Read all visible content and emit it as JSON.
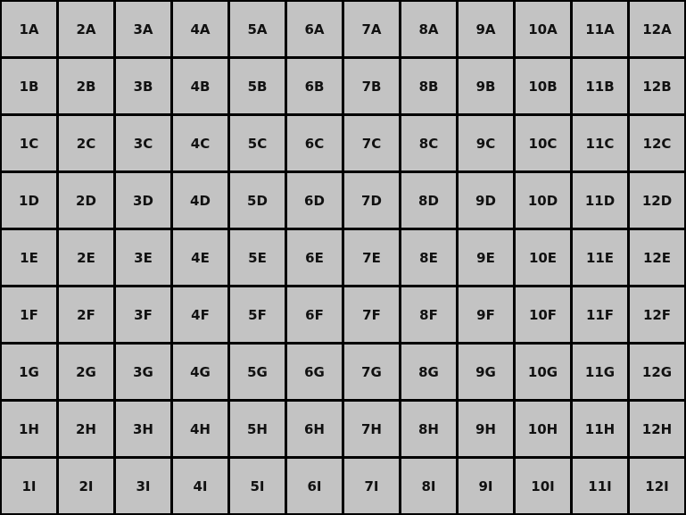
{
  "grid": {
    "columns": [
      "1",
      "2",
      "3",
      "4",
      "5",
      "6",
      "7",
      "8",
      "9",
      "10",
      "11",
      "12"
    ],
    "rows": [
      "A",
      "B",
      "C",
      "D",
      "E",
      "F",
      "G",
      "H",
      "I"
    ],
    "cells": [
      [
        "1A",
        "2A",
        "3A",
        "4A",
        "5A",
        "6A",
        "7A",
        "8A",
        "9A",
        "10A",
        "11A",
        "12A"
      ],
      [
        "1B",
        "2B",
        "3B",
        "4B",
        "5B",
        "6B",
        "7B",
        "8B",
        "9B",
        "10B",
        "11B",
        "12B"
      ],
      [
        "1C",
        "2C",
        "3C",
        "4C",
        "5C",
        "6C",
        "7C",
        "8C",
        "9C",
        "10C",
        "11C",
        "12C"
      ],
      [
        "1D",
        "2D",
        "3D",
        "4D",
        "5D",
        "6D",
        "7D",
        "8D",
        "9D",
        "10D",
        "11D",
        "12D"
      ],
      [
        "1E",
        "2E",
        "3E",
        "4E",
        "5E",
        "6E",
        "7E",
        "8E",
        "9E",
        "10E",
        "11E",
        "12E"
      ],
      [
        "1F",
        "2F",
        "3F",
        "4F",
        "5F",
        "6F",
        "7F",
        "8F",
        "9F",
        "10F",
        "11F",
        "12F"
      ],
      [
        "1G",
        "2G",
        "3G",
        "4G",
        "5G",
        "6G",
        "7G",
        "8G",
        "9G",
        "10G",
        "11G",
        "12G"
      ],
      [
        "1H",
        "2H",
        "3H",
        "4H",
        "5H",
        "6H",
        "7H",
        "8H",
        "9H",
        "10H",
        "11H",
        "12H"
      ],
      [
        "1I",
        "2I",
        "3I",
        "4I",
        "5I",
        "6I",
        "7I",
        "8I",
        "9I",
        "10I",
        "11I",
        "12I"
      ]
    ]
  },
  "colors": {
    "cell_background": "#c3c3c3",
    "grid_lines": "#000000",
    "text": "#111111"
  }
}
